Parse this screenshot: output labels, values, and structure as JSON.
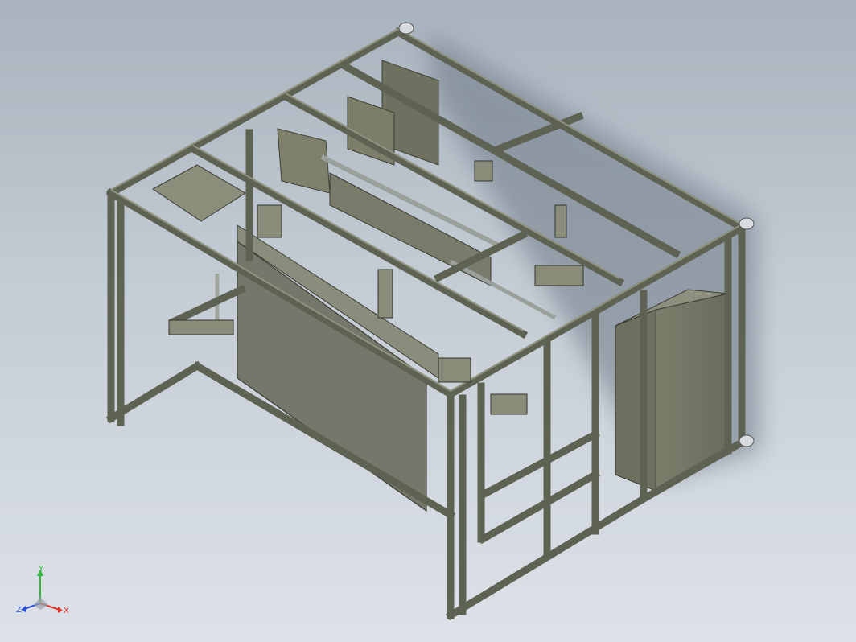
{
  "view": {
    "background_top": "#a9b3bd",
    "background_bottom": "#dde2e8",
    "frame_color": "#5e6253",
    "frame_highlight": "#8f937f",
    "panel_color": "#6f7160",
    "panel_light": "#8a8c79",
    "shadow_color": "#6e7a86"
  },
  "triad": {
    "x_label": "X",
    "y_label": "Y",
    "z_label": "Z",
    "x_color": "#e0322a",
    "y_color": "#33b540",
    "z_color": "#2b4fd6"
  }
}
